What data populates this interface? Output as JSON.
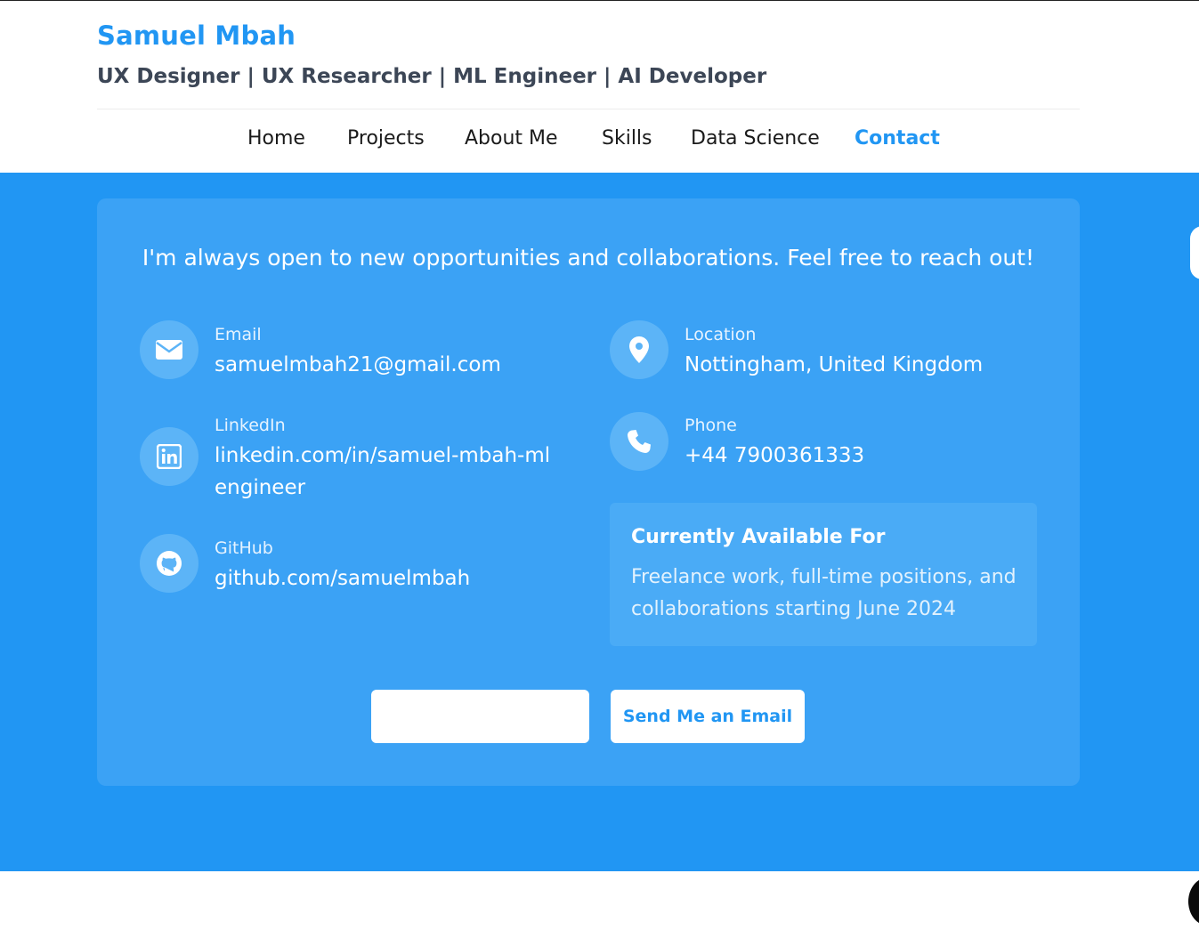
{
  "header": {
    "name": "Samuel Mbah",
    "tagline": "UX Designer | UX Researcher | ML Engineer | AI Developer"
  },
  "nav": {
    "items": [
      {
        "label": "Home"
      },
      {
        "label": "Projects"
      },
      {
        "label": "About Me"
      },
      {
        "label": "Skills"
      },
      {
        "label": "Data Science"
      },
      {
        "label": "Contact",
        "active": true
      }
    ]
  },
  "contact": {
    "intro": "I'm always open to new opportunities and collaborations. Feel free to reach out!",
    "email": {
      "label": "Email",
      "value": "samuelmbah21@gmail.com",
      "icon": "envelope-icon"
    },
    "linkedin": {
      "label": "LinkedIn",
      "value": "linkedin.com/in/samuel-mbah-mlengineer",
      "icon": "linkedin-icon"
    },
    "github": {
      "label": "GitHub",
      "value": "github.com/samuelmbah",
      "icon": "github-icon"
    },
    "location": {
      "label": "Location",
      "value": "Nottingham, United Kingdom",
      "icon": "map-pin-icon"
    },
    "phone": {
      "label": "Phone",
      "value": "+44 7900361333",
      "icon": "phone-icon"
    },
    "availability": {
      "title": "Currently Available For",
      "text": "Freelance work, full-time positions, and collaborations starting June 2024"
    },
    "buttons": {
      "primary_label": "",
      "email_label": "Send Me an Email"
    }
  },
  "colors": {
    "accent": "#2196f3",
    "card": "#3ba2f5",
    "tagline": "#3c4656"
  }
}
